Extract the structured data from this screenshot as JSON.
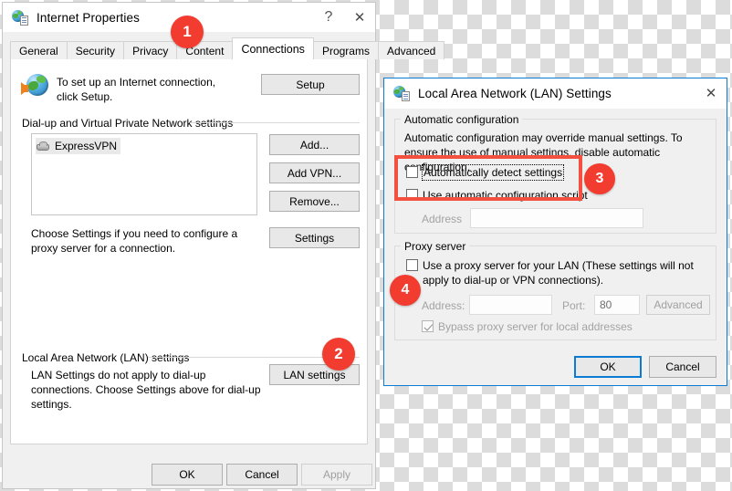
{
  "internet_properties": {
    "title": "Internet Properties",
    "icon": "internet-properties-icon",
    "titlebar_buttons": {
      "help": "?",
      "close": "✕"
    },
    "tabs": [
      {
        "label": "General",
        "active": false
      },
      {
        "label": "Security",
        "active": false
      },
      {
        "label": "Privacy",
        "active": false
      },
      {
        "label": "Content",
        "active": false
      },
      {
        "label": "Connections",
        "active": true
      },
      {
        "label": "Programs",
        "active": false
      },
      {
        "label": "Advanced",
        "active": false
      }
    ],
    "setup": {
      "text": "To set up an Internet connection, click Setup.",
      "button": "Setup",
      "icon": "globe-with-arrow-icon"
    },
    "dialup_group": {
      "label": "Dial-up and Virtual Private Network settings",
      "connections": [
        {
          "name": "ExpressVPN",
          "icon": "modem-icon",
          "selected": true
        }
      ],
      "buttons": [
        "Add...",
        "Add VPN...",
        "Remove...",
        "Settings"
      ],
      "hint": "Choose Settings if you need to configure a proxy server for a connection."
    },
    "lan_group": {
      "label": "Local Area Network (LAN) settings",
      "text": "LAN Settings do not apply to dial-up connections. Choose Settings above for dial-up settings.",
      "button": "LAN settings"
    },
    "footer_buttons": [
      {
        "label": "OK",
        "disabled": false
      },
      {
        "label": "Cancel",
        "disabled": false
      },
      {
        "label": "Apply",
        "disabled": true
      }
    ]
  },
  "lan_settings": {
    "title": "Local Area Network (LAN) Settings",
    "icon": "internet-properties-icon",
    "close_button": "✕",
    "automatic_configuration": {
      "title": "Automatic configuration",
      "description": "Automatic configuration may override manual settings.  To ensure the use of manual settings, disable automatic configuration.",
      "auto_detect": {
        "label": "Automatically detect settings",
        "checked": false,
        "focused": true
      },
      "auto_script": {
        "label": "Use automatic configuration script",
        "checked": false
      },
      "address_label": "Address",
      "address_value": "",
      "address_enabled": false
    },
    "proxy_server": {
      "title": "Proxy server",
      "use_proxy": {
        "label": "Use a proxy server for your LAN (These settings will not apply to dial-up or VPN connections).",
        "checked": false
      },
      "address_label": "Address:",
      "address_value": "",
      "port_label": "Port:",
      "port_value": "80",
      "advanced_button": "Advanced",
      "bypass": {
        "label": "Bypass proxy server for local addresses",
        "checked": true,
        "enabled": false
      }
    },
    "footer_buttons": [
      {
        "label": "OK",
        "default": true
      },
      {
        "label": "Cancel",
        "default": false
      }
    ]
  },
  "annotations": {
    "accent_color": "#f23c30",
    "highlight_color": "#f4503f",
    "badges": [
      {
        "number": "1"
      },
      {
        "number": "2"
      },
      {
        "number": "3"
      },
      {
        "number": "4"
      }
    ]
  }
}
